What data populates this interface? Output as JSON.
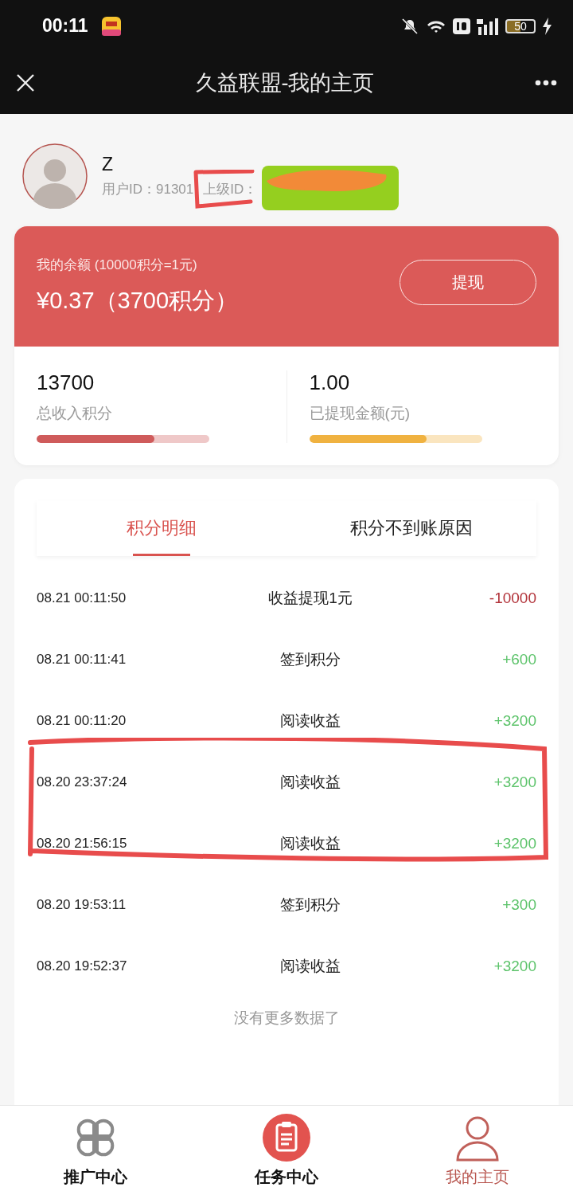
{
  "status_bar": {
    "time": "00:11",
    "battery": "50"
  },
  "header": {
    "title": "久益联盟-我的主页"
  },
  "profile": {
    "name": "Z",
    "user_id": "用户ID：91301",
    "parent_id_label": "上级ID："
  },
  "balance": {
    "label": "我的余额 (10000积分=1元)",
    "amount": "¥0.37（3700积分）",
    "button": "提现"
  },
  "stats": [
    {
      "value": "13700",
      "label": "总收入积分",
      "level": 0.68,
      "color": "#cf5b5b"
    },
    {
      "value": "1.00",
      "label": "已提现金额(元)",
      "level": 0.68,
      "color": "#f0b240"
    }
  ],
  "tabs": [
    {
      "label": "积分明细",
      "selected": true
    },
    {
      "label": "积分不到账原因",
      "selected": false
    }
  ],
  "records": [
    {
      "time": "08.21 00:11:50",
      "title": "收益提现1元",
      "amount": "-10000",
      "kind": "debit"
    },
    {
      "time": "08.21 00:11:41",
      "title": "签到积分",
      "amount": "+600",
      "kind": "credit"
    },
    {
      "time": "08.21 00:11:20",
      "title": "阅读收益",
      "amount": "+3200",
      "kind": "credit"
    },
    {
      "time": "08.20 23:37:24",
      "title": "阅读收益",
      "amount": "+3200",
      "kind": "credit"
    },
    {
      "time": "08.20 21:56:15",
      "title": "阅读收益",
      "amount": "+3200",
      "kind": "credit"
    },
    {
      "time": "08.20 19:53:11",
      "title": "签到积分",
      "amount": "+300",
      "kind": "credit"
    },
    {
      "time": "08.20 19:52:37",
      "title": "阅读收益",
      "amount": "+3200",
      "kind": "credit"
    }
  ],
  "list_end": "没有更多数据了",
  "nav": [
    {
      "label": "推广中心",
      "kind": "clover",
      "selected": false
    },
    {
      "label": "任务中心",
      "kind": "clipboard",
      "selected": false
    },
    {
      "label": "我的主页",
      "kind": "person",
      "selected": true
    }
  ]
}
